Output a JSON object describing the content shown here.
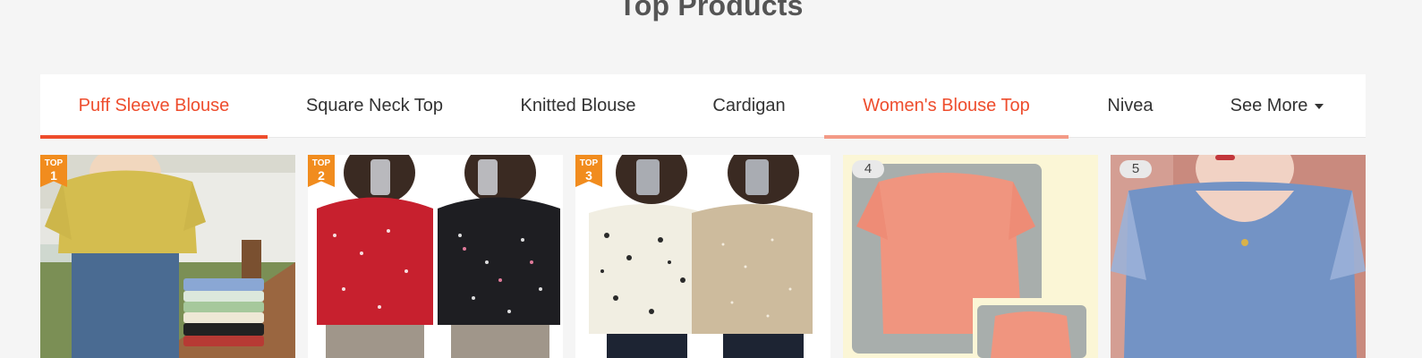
{
  "section": {
    "title": "Top Products"
  },
  "tabs": [
    {
      "label": "Puff Sleeve Blouse"
    },
    {
      "label": "Square Neck Top"
    },
    {
      "label": "Knitted Blouse"
    },
    {
      "label": "Cardigan"
    },
    {
      "label": "Women's Blouse Top"
    },
    {
      "label": "Nivea"
    },
    {
      "label": "See More"
    }
  ],
  "products": [
    {
      "badge_top": "TOP",
      "rank": "1"
    },
    {
      "badge_top": "TOP",
      "rank": "2"
    },
    {
      "badge_top": "TOP",
      "rank": "3"
    },
    {
      "rank": "4"
    },
    {
      "rank": "5"
    }
  ],
  "colors": {
    "accent": "#ee4d2d",
    "badge": "#f18c1e"
  }
}
